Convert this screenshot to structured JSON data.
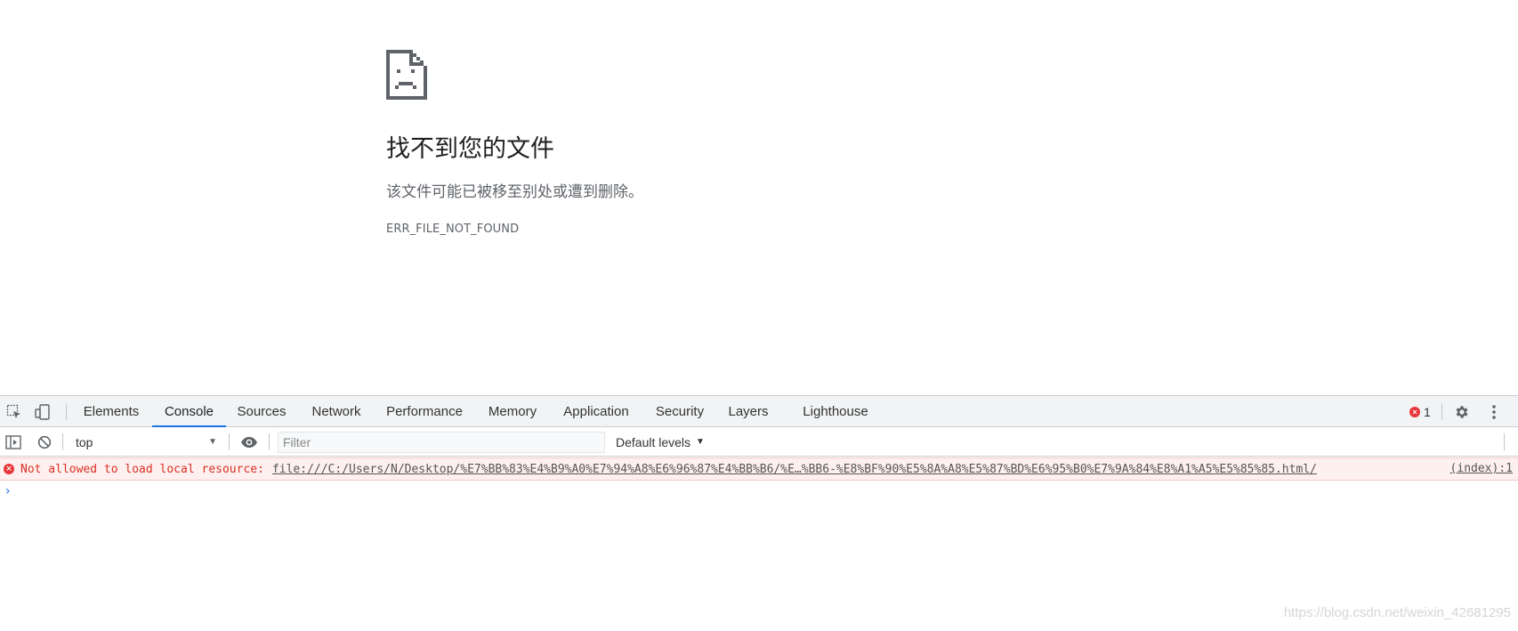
{
  "error_page": {
    "icon": "sad-document-icon",
    "title": "找不到您的文件",
    "description": "该文件可能已被移至别处或遭到删除。",
    "error_code": "ERR_FILE_NOT_FOUND"
  },
  "devtools": {
    "tabbar": {
      "inspect_icon": "inspect-element-icon",
      "device_icon": "device-toolbar-icon",
      "tabs": [
        {
          "label": "Elements"
        },
        {
          "label": "Console"
        },
        {
          "label": "Sources"
        },
        {
          "label": "Network"
        },
        {
          "label": "Performance"
        },
        {
          "label": "Memory"
        },
        {
          "label": "Application"
        },
        {
          "label": "Security"
        },
        {
          "label": "Layers"
        },
        {
          "label": "Lighthouse"
        }
      ],
      "active_tab": "Console",
      "error_count": "1",
      "settings_icon": "gear-icon",
      "more_icon": "more-vertical-icon"
    },
    "toolbar": {
      "sidebar_icon": "console-sidebar-icon",
      "clear_icon": "clear-console-icon",
      "context": "top",
      "eye_icon": "live-expression-eye-icon",
      "filter_placeholder": "Filter",
      "levels": "Default levels"
    },
    "console": {
      "messages": [
        {
          "level": "error",
          "text": "Not allowed to load local resource:",
          "url": "file:///C:/Users/N/Desktop/%E7%BB%83%E4%B9%A0%E7%94%A8%E6%96%87%E4%BB%B6/%E…%BB6-%E8%BF%90%E5%8A%A8%E5%87%BD%E6%95%B0%E7%9A%84%E8%A1%A5%E5%85%85.html/",
          "source": "(index):1"
        }
      ],
      "prompt": "›"
    }
  },
  "watermark": "https://blog.csdn.net/weixin_42681295",
  "colors": {
    "accent": "#1a73e8",
    "error": "#d93025",
    "error_bg": "#fef0ef"
  }
}
